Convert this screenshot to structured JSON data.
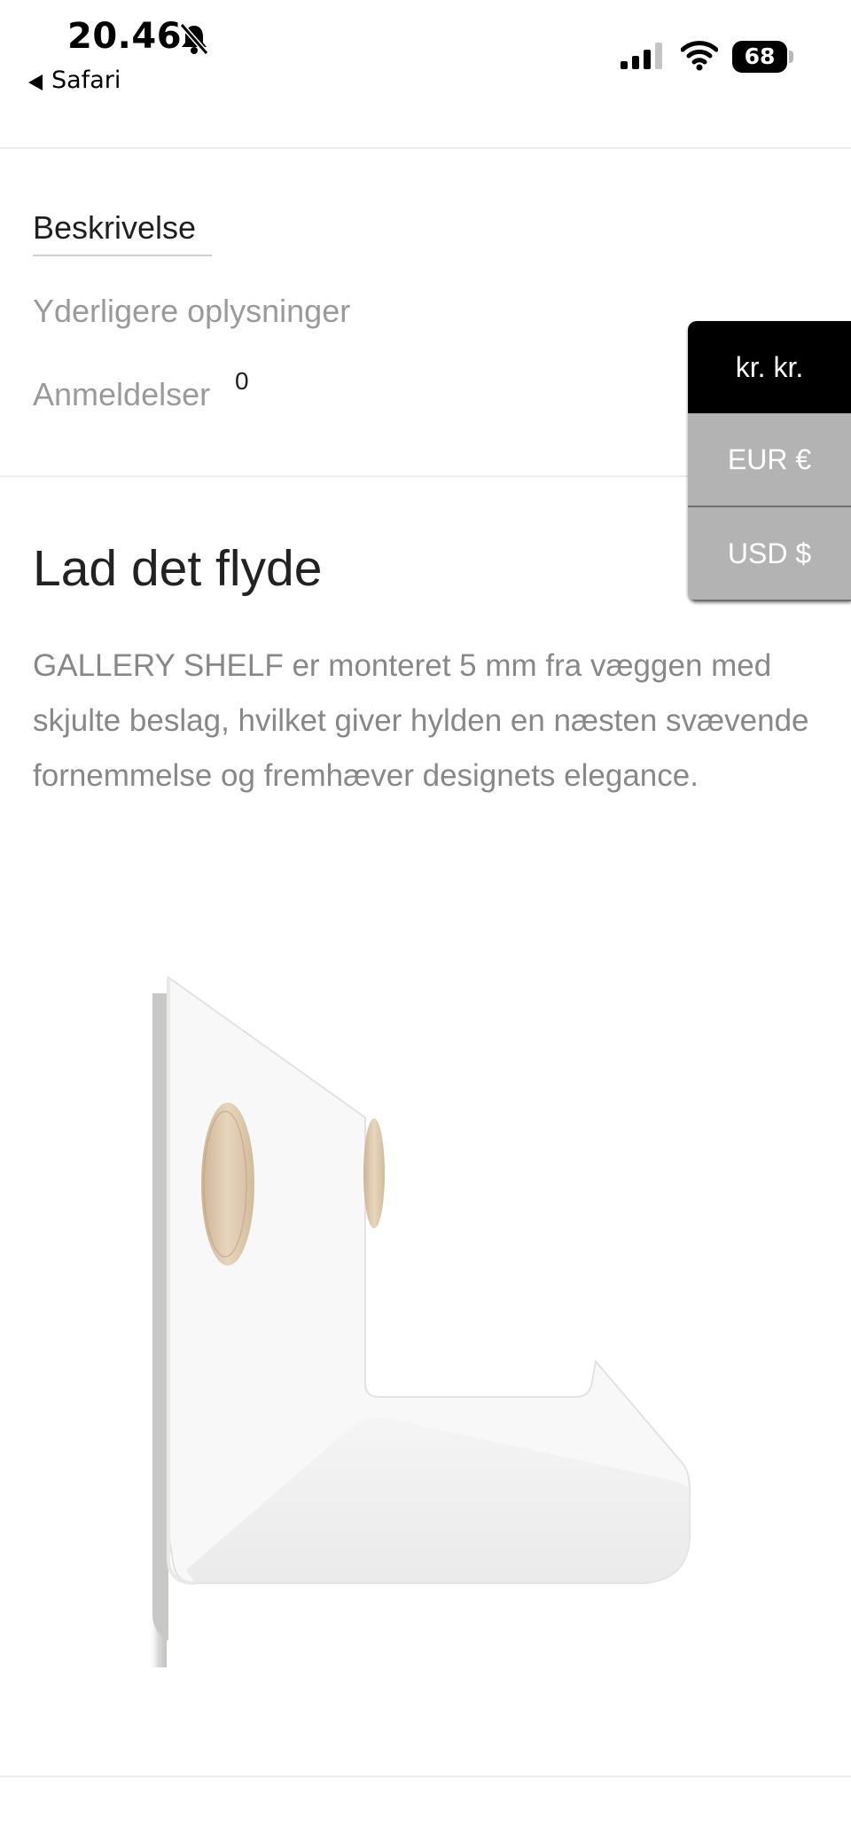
{
  "status_bar": {
    "time": "20.46",
    "back_label": "Safari",
    "battery_level": "68",
    "icons": [
      "bell-slash-icon",
      "back-arrow-icon",
      "cellular-signal-icon",
      "wifi-icon",
      "battery-icon"
    ]
  },
  "tabs": {
    "description": "Beskrivelse",
    "additional_info": "Yderligere oplysninger",
    "reviews": "Anmeldelser",
    "reviews_count": "0"
  },
  "currency": {
    "options": [
      "kr. kr.",
      "EUR €",
      "USD $"
    ],
    "selected": "kr. kr."
  },
  "content": {
    "heading": "Lad det flyde",
    "description": "GALLERY SHELF er monteret 5 mm fra væggen med skjulte beslag, hvilket giver hylden en næsten svævende fornemmelse og fremhæver designets elegance."
  },
  "colors": {
    "text_dark": "#222222",
    "text_muted": "#888888",
    "currency_active_bg": "#000000",
    "currency_inactive_bg": "#b3b3b3"
  }
}
